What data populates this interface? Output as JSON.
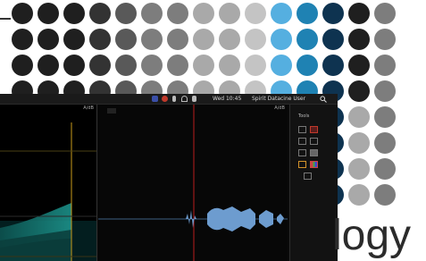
{
  "palette": {
    "black": "#1f1f1f",
    "dark_gray": "#333333",
    "mid_gray": "#595959",
    "gray": "#7d7d7d",
    "light_gray": "#a9a9a9",
    "pale_gray": "#c4c4c4",
    "sky_blue": "#55afe0",
    "teal_blue": "#1f82b3",
    "navy": "#0e3350"
  },
  "topbar": {
    "clock": "Wed 10:45",
    "user": "Spirit Datacine User",
    "search_icon": "search-icon",
    "icons": [
      "app-menu-icon",
      "browser-icon",
      "bluetooth-icon",
      "wifi-icon",
      "volume-icon"
    ]
  },
  "spectrogram_panel": {
    "header": "A/dB"
  },
  "waveform_panel": {
    "header": "A/dB"
  },
  "tool_panel": {
    "title": "Tools",
    "tools": [
      "select-tool-icon",
      "record-tool-icon",
      "zoom-tool-icon",
      "loop-tool-icon",
      "cut-tool-icon",
      "grid-tool-icon",
      "color-tool-icon",
      "channel-tool-icon",
      "list-tool-icon"
    ]
  },
  "logo_text": "logy"
}
